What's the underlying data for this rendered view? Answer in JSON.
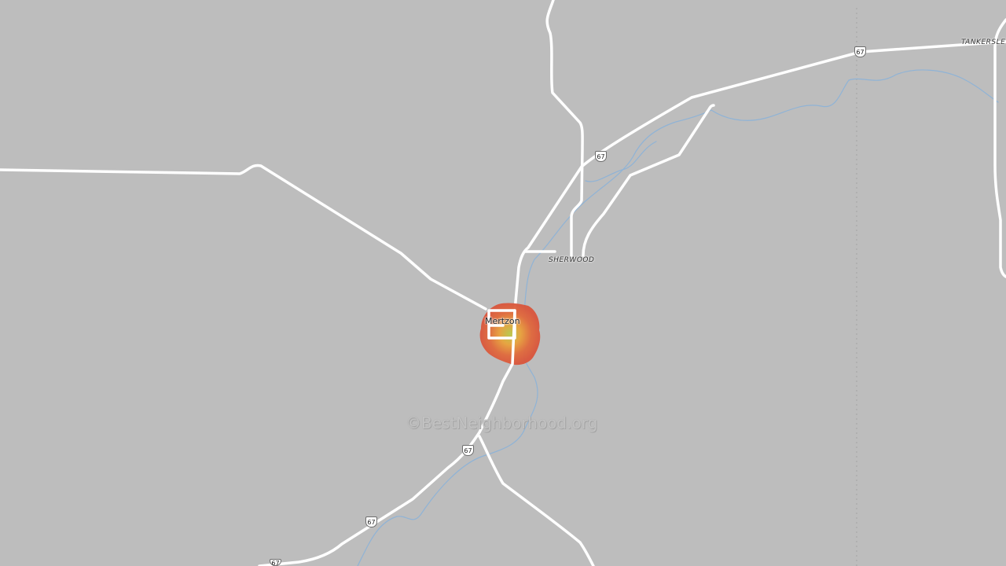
{
  "map": {
    "colors": {
      "background": "#bdbdbd",
      "road": "#ffffff",
      "river": "#8fb3d6",
      "heat_outer": "#d9553b",
      "heat_mid": "#e9a23b",
      "heat_center": "#b9c94a"
    },
    "places": {
      "mertzon": "Mertzon",
      "sherwood": "SHERWOOD",
      "tankersley": "TANKERSLE"
    },
    "route_shields": {
      "us_67_a": "67",
      "us_67_b": "67",
      "us_67_c": "67",
      "us_67_d": "67",
      "us_67_e": "67"
    },
    "shield_icon": "us-highway-shield-icon",
    "watermark": "©BestNeighborhood.org"
  }
}
